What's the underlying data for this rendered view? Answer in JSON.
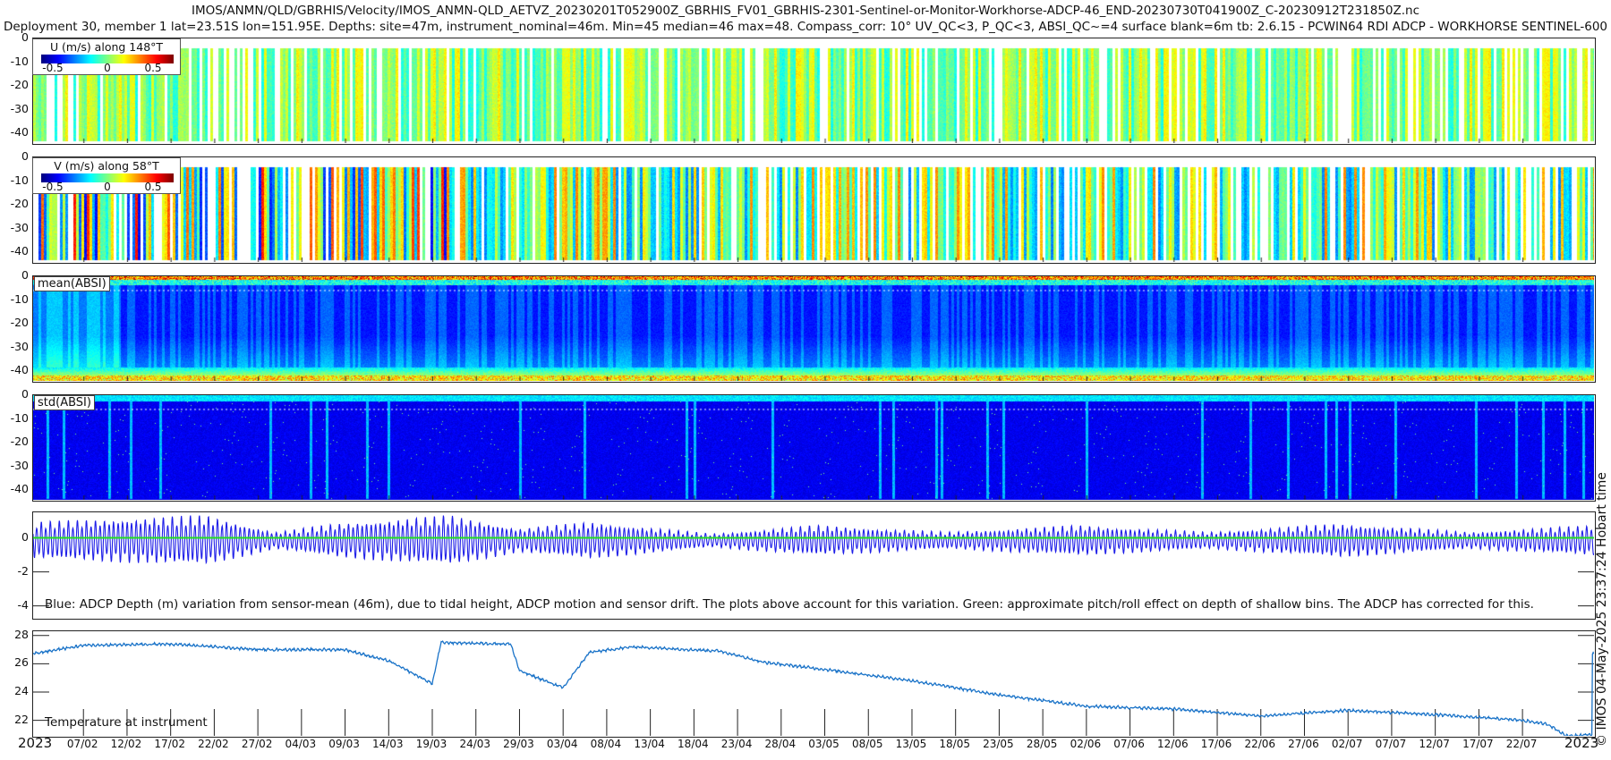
{
  "header": {
    "title_line1": "IMOS/ANMN/QLD/GBRHIS/Velocity/IMOS_ANMN-QLD_AETVZ_20230201T052900Z_GBRHIS_FV01_GBRHIS-2301-Sentinel-or-Monitor-Workhorse-ADCP-46_END-20230730T041900Z_C-20230912T231850Z.nc",
    "title_line2": "Deployment 30, member 1 lat=23.51S lon=151.95E. Depths: site=47m, instrument_nominal=46m. Min=45 median=46 max=48. Compass_corr: 10° UV_QC<3, P_QC<3, ABSI_QC~=4 surface blank=6m tb: 2.6.15 - PCWIN64 RDI ADCP - WORKHORSE SENTINEL-600"
  },
  "side_text": "© IMOS 04-May-2025 23:37:24 Hobart time",
  "colors": {
    "axis": "#222222",
    "depth_line": "#1f1fe8",
    "pitch_line": "#22dd22",
    "temp_line": "#1a73c8"
  },
  "chart_data": [
    {
      "type": "heatmap",
      "name": "U",
      "legend_title": "U (m/s) along 148°T",
      "colorbar_ticks": [
        "-0.5",
        "0",
        "0.5"
      ],
      "clim": [
        -0.7,
        0.7
      ],
      "yticks": [
        "0",
        "-10",
        "-20",
        "-30",
        "-40"
      ],
      "ylim": [
        -44,
        0
      ]
    },
    {
      "type": "heatmap",
      "name": "V",
      "legend_title": "V (m/s) along 58°T",
      "colorbar_ticks": [
        "-0.5",
        "0",
        "0.5"
      ],
      "clim": [
        -0.7,
        0.7
      ],
      "yticks": [
        "0",
        "-10",
        "-20",
        "-30",
        "-40"
      ],
      "ylim": [
        -44,
        0
      ]
    },
    {
      "type": "heatmap",
      "name": "mean(ABSI)",
      "label": "mean(ABSI)",
      "yticks": [
        "0",
        "-10",
        "-20",
        "-30",
        "-40"
      ],
      "ylim": [
        -44,
        0
      ]
    },
    {
      "type": "heatmap",
      "name": "std(ABSI)",
      "label": "std(ABSI)",
      "yticks": [
        "0",
        "-10",
        "-20",
        "-30",
        "-40"
      ],
      "ylim": [
        -44,
        0
      ]
    },
    {
      "type": "line",
      "name": "ADCP depth variation",
      "yticks": [
        "0",
        "-2",
        "-4"
      ],
      "ylim": [
        -4.7,
        1.5
      ],
      "note": "Blue: ADCP Depth (m) variation from sensor-mean (46m), due to tidal height, ADCP motion and sensor drift. The plots above account for this variation. Green: approximate pitch/roll effect on depth of shallow bins. The ADCP has corrected for this.",
      "tidal_cycles_per_day": 1.93,
      "amplitude_envelope": {
        "day": [
          0,
          20,
          28,
          35,
          48,
          56,
          64,
          78,
          90,
          105,
          120,
          135,
          150,
          165,
          179
        ],
        "amp_m": [
          1.1,
          1.5,
          0.5,
          1.0,
          1.5,
          0.7,
          1.1,
          0.4,
          0.9,
          0.5,
          0.9,
          0.5,
          1.0,
          0.5,
          0.9
        ]
      },
      "pitch_roll_value_m": 0
    },
    {
      "type": "line",
      "name": "Temperature",
      "label": "Temperature at instrument",
      "yticks": [
        "28",
        "26",
        "24",
        "22"
      ],
      "ylim": [
        20.9,
        28.3
      ],
      "x_day": [
        0,
        6,
        16,
        26,
        36,
        41,
        46,
        47,
        55,
        56,
        61,
        64,
        69,
        79,
        84,
        91,
        101,
        111,
        121,
        131,
        141,
        151,
        161,
        171,
        174,
        176,
        179
      ],
      "y_degC": [
        26.7,
        27.3,
        27.4,
        27.0,
        27.0,
        26.2,
        24.6,
        27.5,
        27.4,
        25.5,
        24.3,
        26.8,
        27.2,
        26.9,
        26.1,
        25.6,
        24.8,
        23.8,
        23.0,
        22.8,
        22.3,
        22.7,
        22.4,
        22.0,
        21.7,
        20.9,
        21.0
      ]
    }
  ],
  "xaxis": {
    "start_year": "2023",
    "end_year": "2023",
    "xlim_day": [
      0.23,
      179.2
    ],
    "ticks": [
      {
        "day": 6,
        "label": "07/02"
      },
      {
        "day": 11,
        "label": "12/02"
      },
      {
        "day": 16,
        "label": "17/02"
      },
      {
        "day": 21,
        "label": "22/02"
      },
      {
        "day": 26,
        "label": "27/02"
      },
      {
        "day": 31,
        "label": "04/03"
      },
      {
        "day": 36,
        "label": "09/03"
      },
      {
        "day": 41,
        "label": "14/03"
      },
      {
        "day": 46,
        "label": "19/03"
      },
      {
        "day": 51,
        "label": "24/03"
      },
      {
        "day": 56,
        "label": "29/03"
      },
      {
        "day": 61,
        "label": "03/04"
      },
      {
        "day": 66,
        "label": "08/04"
      },
      {
        "day": 71,
        "label": "13/04"
      },
      {
        "day": 76,
        "label": "18/04"
      },
      {
        "day": 81,
        "label": "23/04"
      },
      {
        "day": 86,
        "label": "28/04"
      },
      {
        "day": 91,
        "label": "03/05"
      },
      {
        "day": 96,
        "label": "08/05"
      },
      {
        "day": 101,
        "label": "13/05"
      },
      {
        "day": 106,
        "label": "18/05"
      },
      {
        "day": 111,
        "label": "23/05"
      },
      {
        "day": 116,
        "label": "28/05"
      },
      {
        "day": 121,
        "label": "02/06"
      },
      {
        "day": 126,
        "label": "07/06"
      },
      {
        "day": 131,
        "label": "12/06"
      },
      {
        "day": 136,
        "label": "17/06"
      },
      {
        "day": 141,
        "label": "22/06"
      },
      {
        "day": 146,
        "label": "27/06"
      },
      {
        "day": 151,
        "label": "02/07"
      },
      {
        "day": 156,
        "label": "07/07"
      },
      {
        "day": 161,
        "label": "12/07"
      },
      {
        "day": 166,
        "label": "17/07"
      },
      {
        "day": 171,
        "label": "22/07"
      }
    ]
  }
}
